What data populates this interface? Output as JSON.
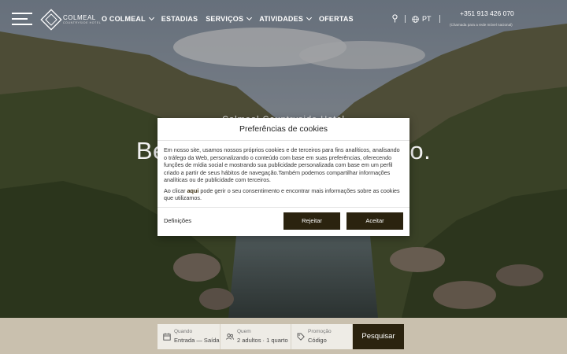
{
  "header": {
    "logo_word": "COLMEAL",
    "logo_sub": "COUNTRYSIDE HOTEL",
    "nav": [
      {
        "label": "O COLMEAL",
        "has_dropdown": true
      },
      {
        "label": "ESTADIAS",
        "has_dropdown": false
      },
      {
        "label": "SERVIÇOS",
        "has_dropdown": true
      },
      {
        "label": "ATIVIDADES",
        "has_dropdown": true
      },
      {
        "label": "OFERTAS",
        "has_dropdown": false
      }
    ],
    "language": "PT",
    "phone": "+351 913 426 070",
    "phone_note": "(Chamada para a rede móvel nacional)"
  },
  "hero": {
    "kicker": "Colmeal Countryside Hotel",
    "title": "Bem-vindo ao seu refúgio."
  },
  "cookie_modal": {
    "title": "Preferências de cookies",
    "paragraph1": "Em nosso site, usamos nossos próprios cookies e de terceiros para fins analíticos, analisando o tráfego da Web, personalizando o conteúdo com base em suas preferências, oferecendo funções de mídia social e mostrando sua publicidade personalizada com base em um perfil criado a partir de seus hábitos de navegação.Também podemos compartilhar informações analíticas ou de publicidade com terceiros.",
    "paragraph2_prefix": "Ao clicar ",
    "paragraph2_link": "aqui",
    "paragraph2_suffix": " pode gerir o seu consentimento e encontrar mais informações sobre as cookies que utilizamos.",
    "settings_label": "Definições",
    "reject_label": "Rejeitar",
    "accept_label": "Aceitar"
  },
  "booking": {
    "when_label": "Quando",
    "when_value": "Entrada — Saída",
    "who_label": "Quem",
    "who_value": "2 adultos · 1 quarto",
    "promo_label": "Promoção",
    "promo_value": "Código",
    "search_label": "Pesquisar"
  },
  "colors": {
    "accent_dark": "#2b230f",
    "booking_bar": "#c9c0ae"
  },
  "icons": [
    "hamburger-menu-icon",
    "location-pin-icon",
    "globe-icon",
    "calendar-icon",
    "people-icon",
    "tag-icon"
  ]
}
